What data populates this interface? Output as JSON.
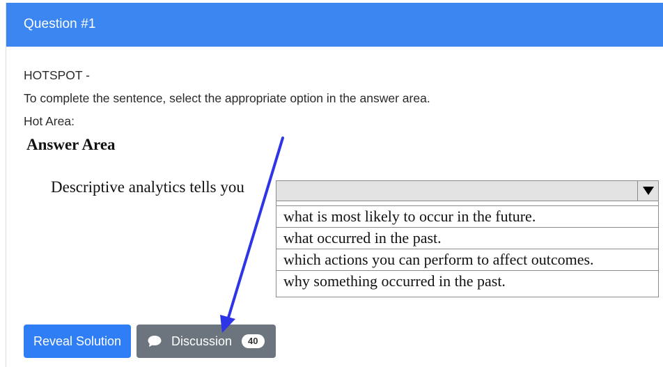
{
  "header": {
    "title": "Question #1"
  },
  "question": {
    "type_label": "HOTSPOT -",
    "instruction": "To complete the sentence, select the appropriate option in the answer area.",
    "hot_area_label": "Hot Area:"
  },
  "answer_area": {
    "title": "Answer Area",
    "sentence": "Descriptive analytics tells you",
    "dropdown": {
      "selected": "",
      "icon": "triangle-down-icon",
      "options": [
        "what is most likely to occur in the future.",
        "what occurred in the past.",
        "which actions you can perform to affect outcomes.",
        "why something occurred in the past."
      ]
    }
  },
  "actions": {
    "reveal_label": "Reveal Solution",
    "discussion_label": "Discussion",
    "discussion_count": "40",
    "discussion_icon": "chat-bubble-icon"
  },
  "colors": {
    "header_bg": "#3b86f1",
    "reveal_bg": "#2f7ef5",
    "discussion_bg": "#6c757d",
    "annotation_arrow": "#2e35e6"
  }
}
